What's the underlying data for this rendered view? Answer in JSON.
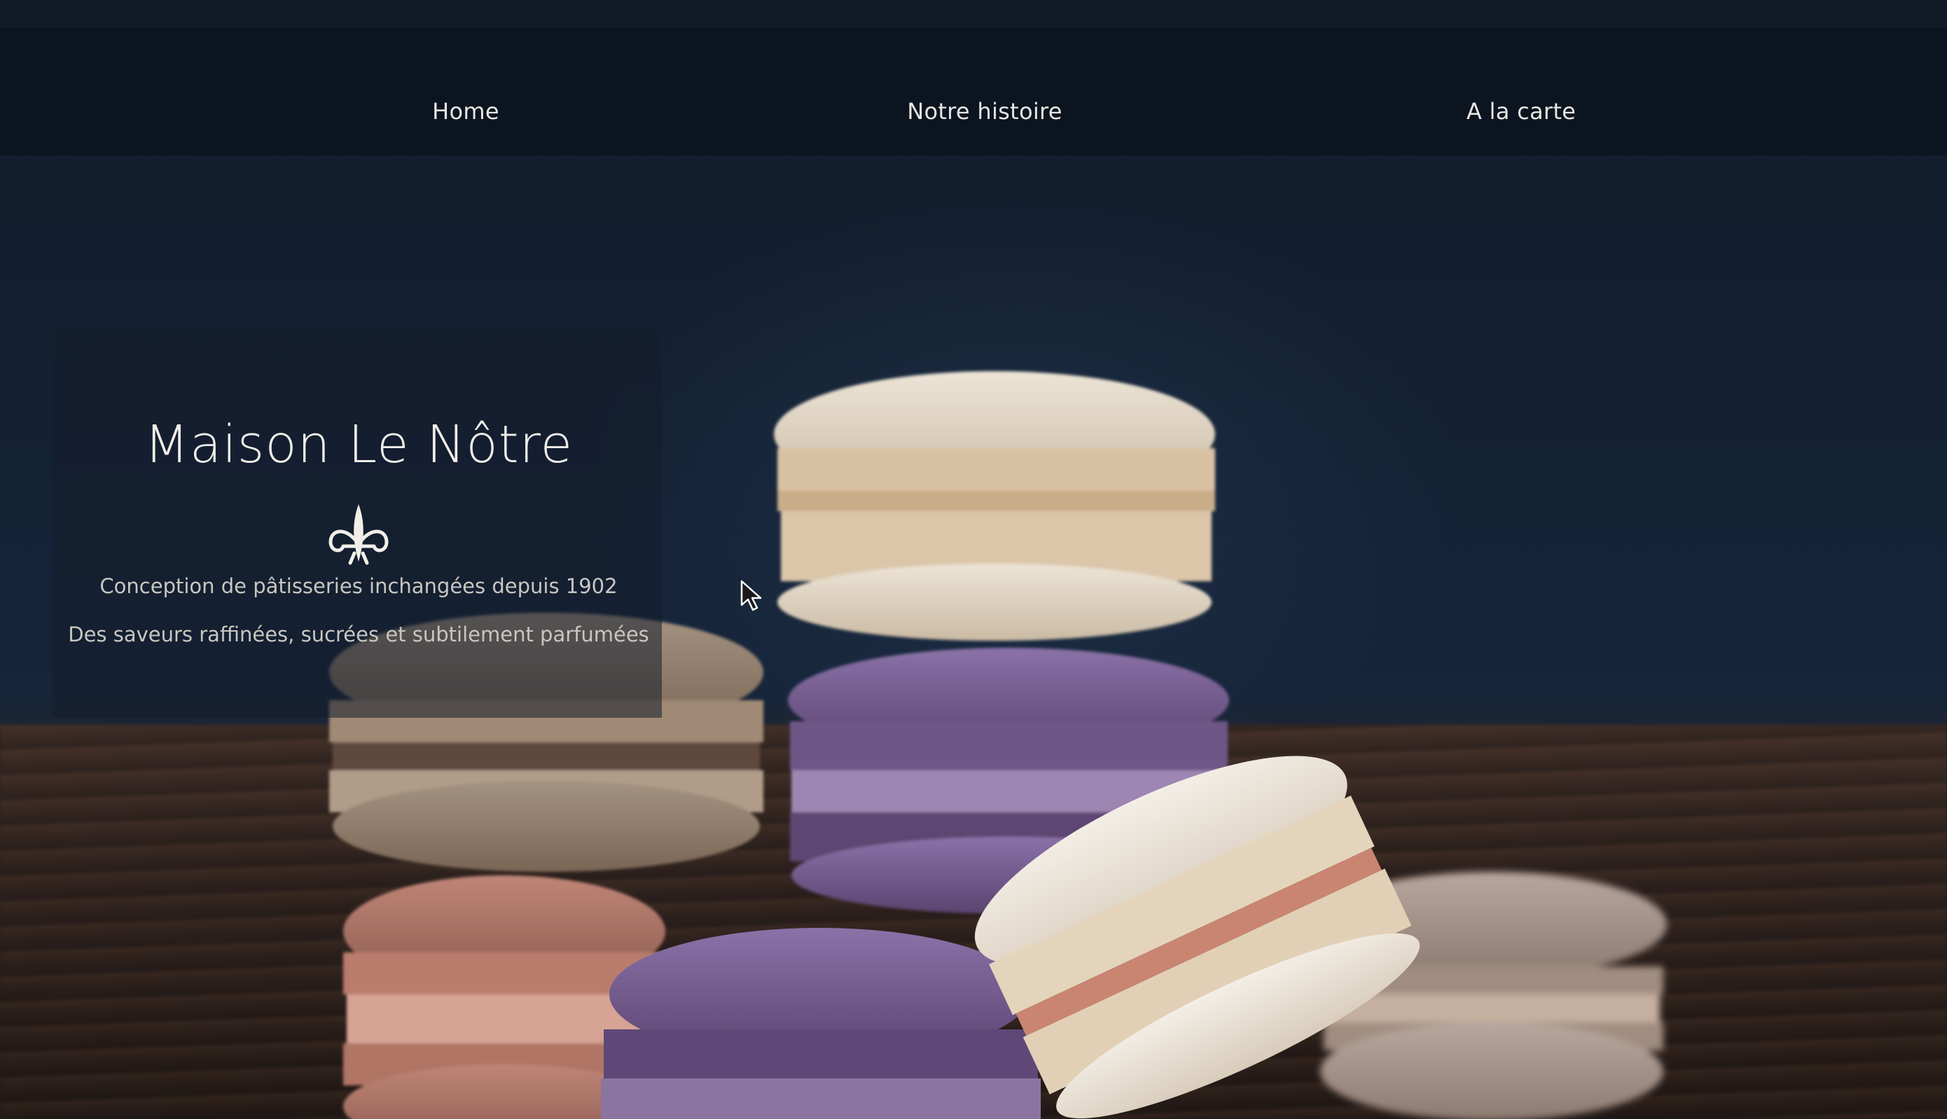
{
  "nav": {
    "items": [
      {
        "label": "Home"
      },
      {
        "label": "Notre histoire"
      },
      {
        "label": "A la carte"
      }
    ]
  },
  "hero": {
    "title": "Maison Le Nôtre",
    "logo_icon": "fleur-de-lis-icon",
    "tagline_1": "Conception de pâtisseries inchangées depuis 1902",
    "tagline_2": "Des saveurs raffinées, sucrées et subtilement parfumées"
  },
  "colors": {
    "navbar_bg": "#0c1420",
    "nav_text": "#e8e6e2",
    "hero_bg": "#142236",
    "title_text": "#f0ede8"
  }
}
